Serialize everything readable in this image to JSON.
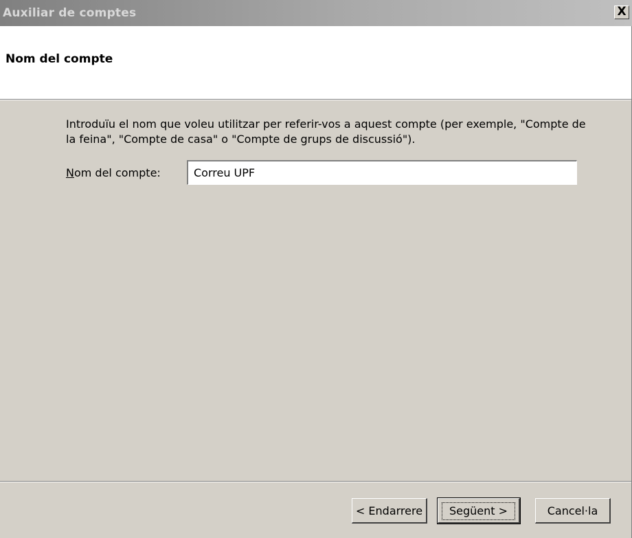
{
  "window": {
    "title": "Auxiliar de comptes",
    "close_label": "X"
  },
  "header": {
    "title": "Nom del compte"
  },
  "content": {
    "instruction": "Introduïu el nom que voleu utilitzar per referir-vos a aquest compte (per exemple, \"Compte de la feina\", \"Compte de casa\" o \"Compte de grups de discussió\").",
    "field_label_accel": "N",
    "field_label_rest": "om del compte:",
    "account_name_value": "Correu UPF"
  },
  "buttons": {
    "back_label": "< Endarrere",
    "next_label": "Següent >",
    "cancel_label": "Cancel·la"
  }
}
